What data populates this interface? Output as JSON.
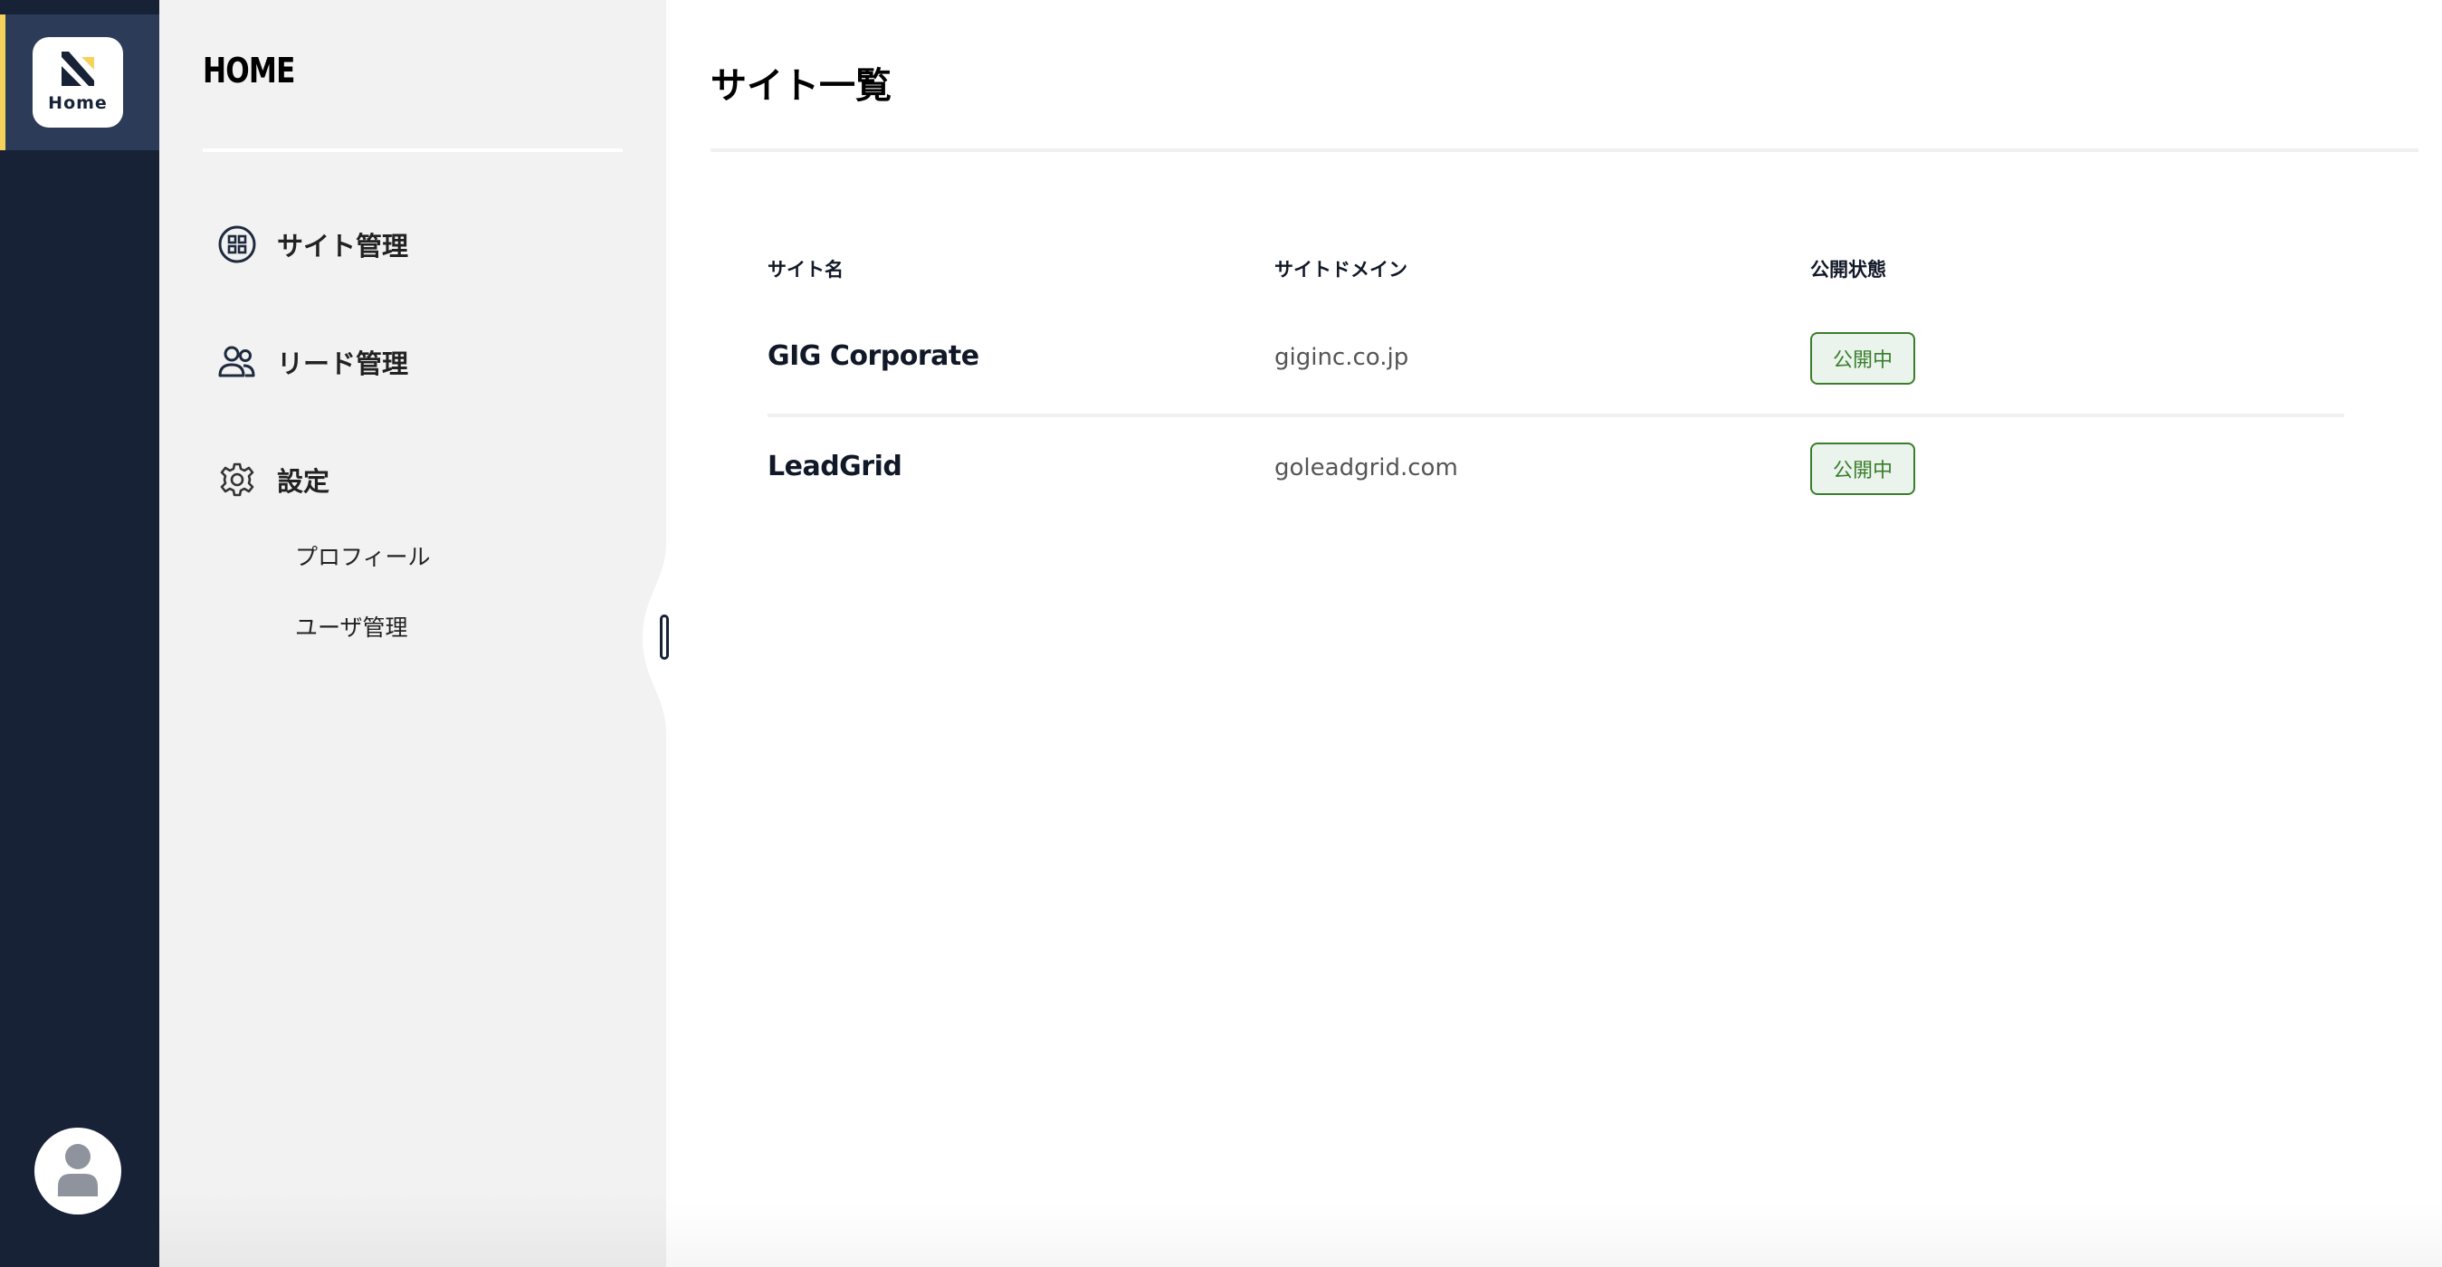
{
  "rail": {
    "home_label": "Home",
    "icons": {
      "logo": "brand-logo-icon",
      "avatar": "user-avatar-icon"
    },
    "colors": {
      "rail_bg": "#172236",
      "active_bg": "#2c3c58",
      "accent": "#f5d25a"
    }
  },
  "panel": {
    "title": "HOME",
    "nav": [
      {
        "label": "サイト管理",
        "icon": "grid-circle-icon"
      },
      {
        "label": "リード管理",
        "icon": "users-icon"
      },
      {
        "label": "設定",
        "icon": "gear-icon"
      }
    ],
    "settings_sub": [
      {
        "label": "プロフィール"
      },
      {
        "label": "ユーザ管理"
      }
    ]
  },
  "main": {
    "title": "サイト一覧",
    "table": {
      "headers": [
        "サイト名",
        "サイトドメイン",
        "公開状態"
      ],
      "rows": [
        {
          "name": "GIG Corporate",
          "domain": "giginc.co.jp",
          "status": "公開中"
        },
        {
          "name": "LeadGrid",
          "domain": "goleadgrid.com",
          "status": "公開中"
        }
      ]
    },
    "colors": {
      "status_published": "#3a7d2c",
      "status_published_bg": "#eaf4ec"
    }
  }
}
